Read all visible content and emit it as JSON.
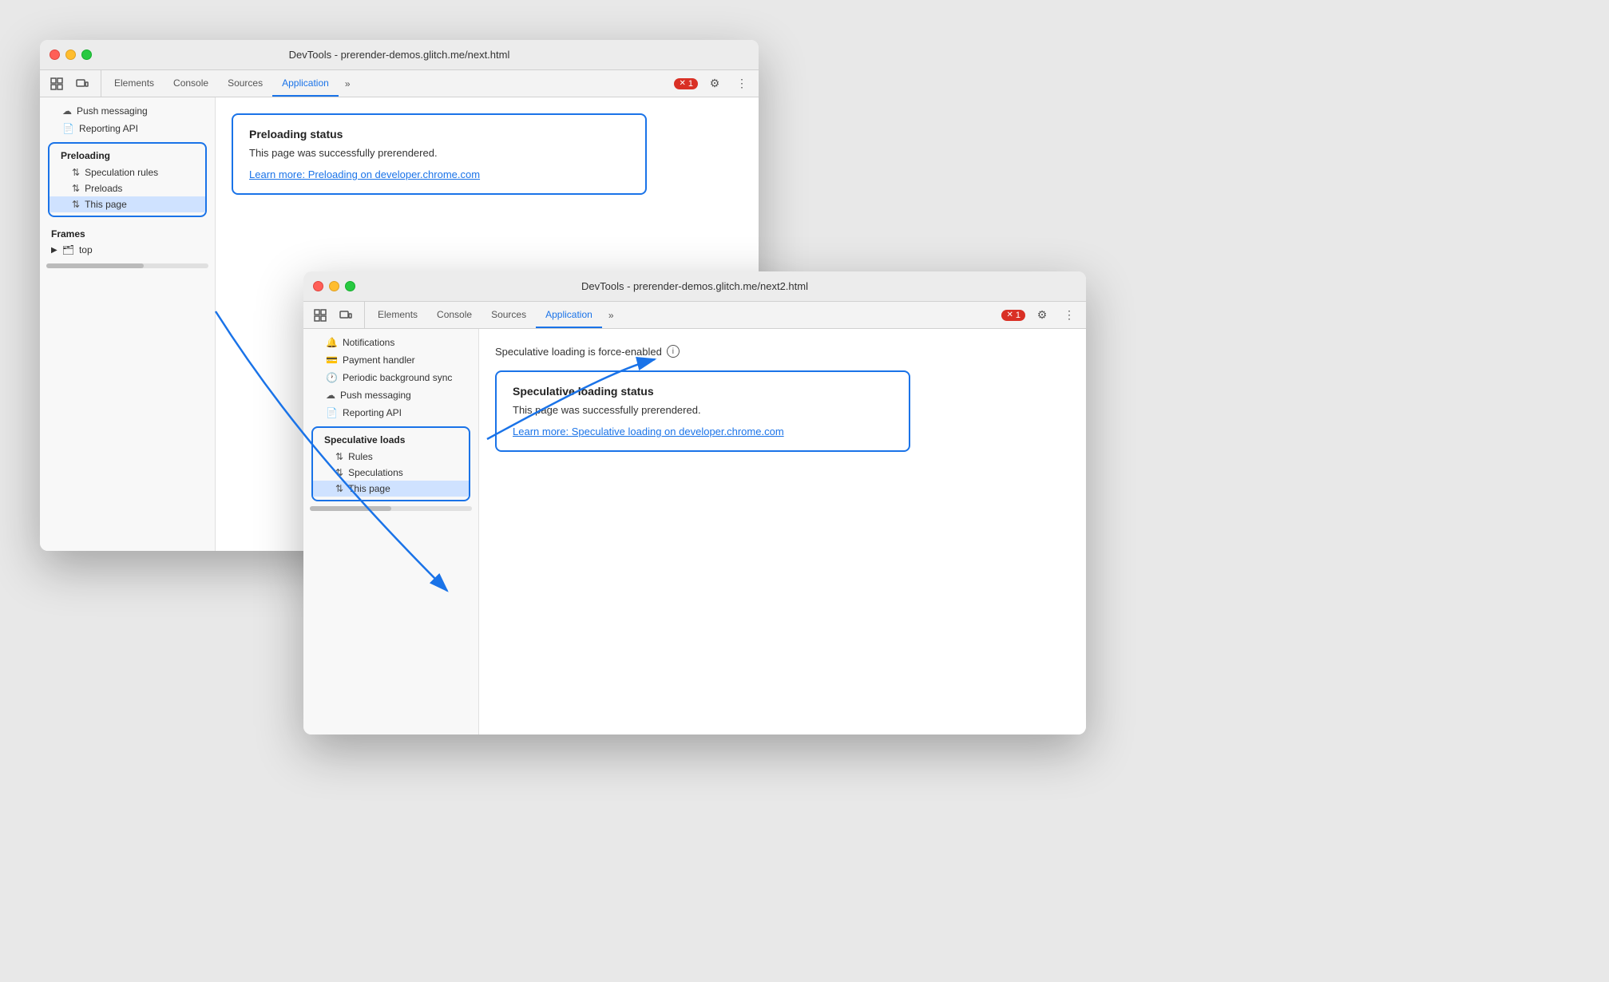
{
  "window1": {
    "title": "DevTools - prerender-demos.glitch.me/next.html",
    "tabs": {
      "icons": [
        "⬚",
        "⬒"
      ],
      "items": [
        "Elements",
        "Console",
        "Sources",
        "Application"
      ],
      "active": "Application",
      "more": "»",
      "error_count": "1"
    },
    "sidebar": {
      "items_above": [
        "Push messaging",
        "Reporting API"
      ],
      "preloading_group": {
        "title": "Preloading",
        "items": [
          {
            "label": "Speculation rules",
            "icon": "↑↓"
          },
          {
            "label": "Preloads",
            "icon": "↑↓"
          },
          {
            "label": "This page",
            "icon": "↑↓",
            "active": true
          }
        ]
      },
      "frames_section": {
        "title": "Frames",
        "items": [
          {
            "label": "top",
            "icon": "▶"
          }
        ]
      }
    },
    "main": {
      "card": {
        "title": "Preloading status",
        "text": "This page was successfully prerendered.",
        "link": "Learn more: Preloading on developer.chrome.com"
      }
    }
  },
  "window2": {
    "title": "DevTools - prerender-demos.glitch.me/next2.html",
    "tabs": {
      "icons": [
        "⬚",
        "⬒"
      ],
      "items": [
        "Elements",
        "Console",
        "Sources",
        "Application"
      ],
      "active": "Application",
      "more": "»",
      "error_count": "1"
    },
    "sidebar": {
      "items_above": [
        "Notifications",
        "Payment handler",
        "Periodic background sync",
        "Push messaging",
        "Reporting API"
      ],
      "speculative_group": {
        "title": "Speculative loads",
        "items": [
          {
            "label": "Rules",
            "icon": "↑↓"
          },
          {
            "label": "Speculations",
            "icon": "↑↓"
          },
          {
            "label": "This page",
            "icon": "↑↓",
            "active": true
          }
        ]
      }
    },
    "main": {
      "force_enabled": "Speculative loading is force-enabled",
      "card": {
        "title": "Speculative loading status",
        "text": "This page was successfully prerendered.",
        "link": "Learn more: Speculative loading on developer.chrome.com"
      }
    }
  },
  "icons": {
    "cursor": "⬚",
    "responsive": "⬒",
    "more_tabs": "»",
    "settings": "⚙",
    "dots": "⋮",
    "push_msg": "☁",
    "reporting": "📄",
    "payment": "💳",
    "periodic": "🕐",
    "updown": "⇅",
    "frame": "▶",
    "folder": "📁",
    "info": "i"
  }
}
